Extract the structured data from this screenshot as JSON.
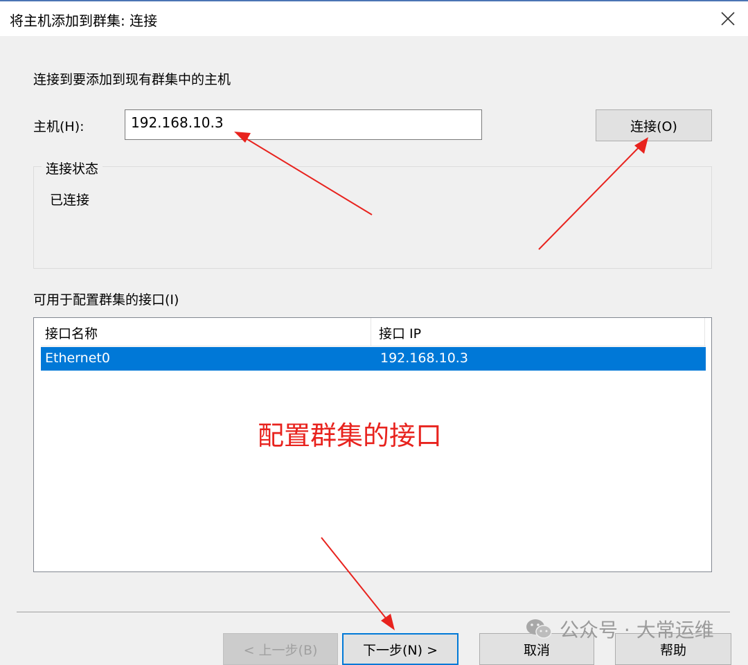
{
  "window": {
    "title": "将主机添加到群集: 连接"
  },
  "form": {
    "instruction": "连接到要添加到现有群集中的主机",
    "host_label": "主机(H):",
    "host_value": "192.168.10.3",
    "connect_button": "连接(O)"
  },
  "status": {
    "legend": "连接状态",
    "text": "已连接"
  },
  "interfaces": {
    "label": "可用于配置群集的接口(I)",
    "columns": [
      "接口名称",
      "接口 IP"
    ],
    "rows": [
      {
        "name": "Ethernet0",
        "ip": "192.168.10.3"
      }
    ]
  },
  "annotation": {
    "text": "配置群集的接口",
    "color": "#e8231e"
  },
  "footer": {
    "back_button": "< 上一步(B)",
    "next_button": "下一步(N) >",
    "cancel_button": "取消",
    "help_button": "帮助"
  },
  "watermark": {
    "text": "公众号 · 大常运维"
  },
  "colors": {
    "accent": "#0078d7",
    "annotation": "#e8231e"
  },
  "icons": {
    "close": "close-icon",
    "watermark": "wechat-icon"
  }
}
